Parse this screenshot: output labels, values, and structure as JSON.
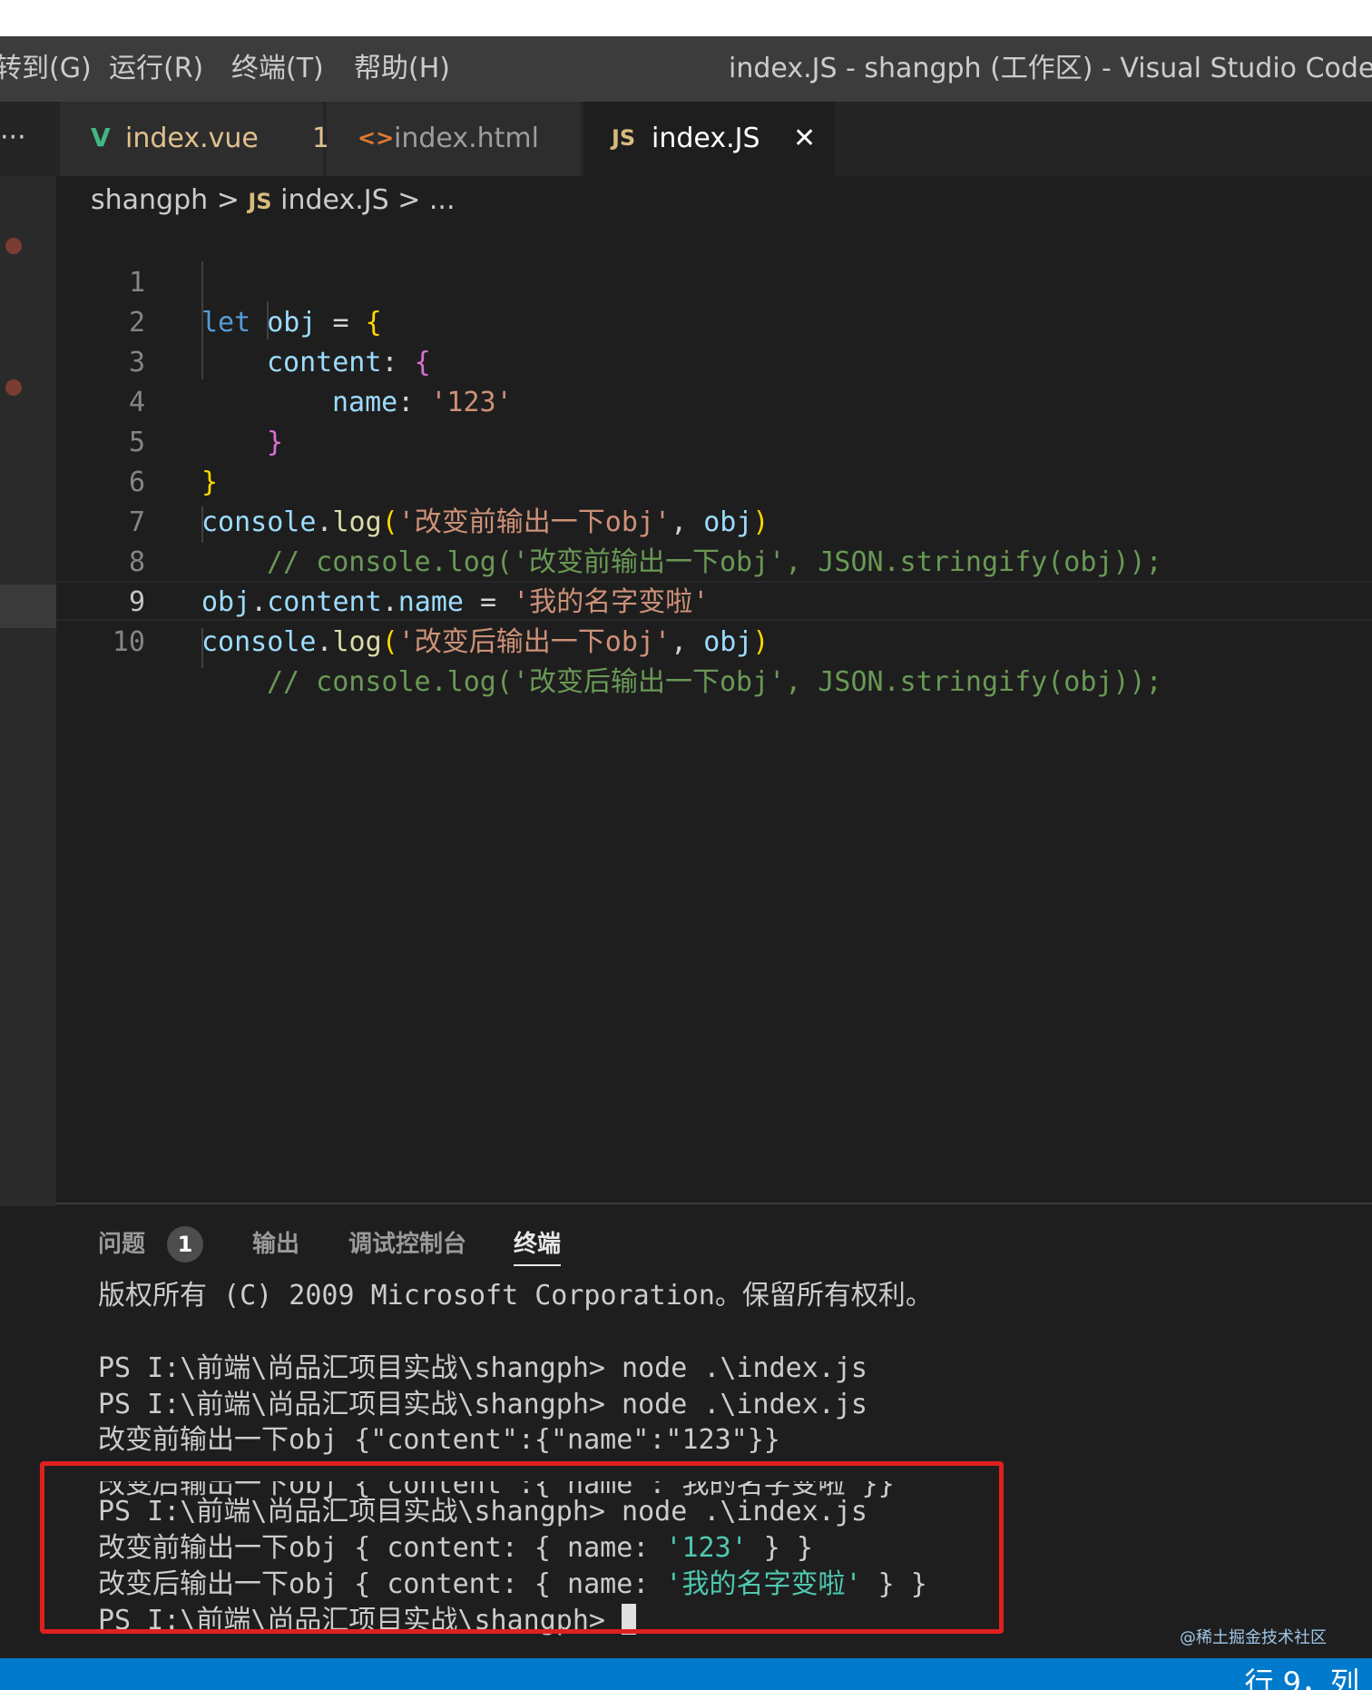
{
  "menu": {
    "items": [
      "转到(G)",
      "运行(R)",
      "终端(T)",
      "帮助(H)"
    ],
    "window_title": "index.JS - shangph (工作区) - Visual Studio Code [管理员]"
  },
  "tabs": {
    "more": "···",
    "items": [
      {
        "icon": "V",
        "label": "index.vue",
        "badge": "1"
      },
      {
        "icon": "<>",
        "label": "index.html"
      },
      {
        "icon": "JS",
        "label": "index.JS",
        "close": "✕"
      }
    ]
  },
  "breadcrumb": {
    "folder": "shangph",
    "sep": ">",
    "icon": "JS",
    "file": "index.JS",
    "tail": "> ..."
  },
  "code": {
    "line_numbers": [
      "1",
      "2",
      "3",
      "4",
      "5",
      "6",
      "7",
      "8",
      "9",
      "10"
    ],
    "current_line": "9",
    "l1": {
      "kw": "let",
      "name": " obj",
      "eq": " = ",
      "brace": "{"
    },
    "l2": {
      "key": "content",
      "colon": ": ",
      "brace": "{"
    },
    "l3": {
      "key": "name",
      "colon": ": ",
      "val": "'123'"
    },
    "l4": {
      "brace": "}"
    },
    "l5": {
      "brace": "}"
    },
    "l6": {
      "obj": "console",
      "dot": ".",
      "fn": "log",
      "open": "(",
      "str": "'改变前输出一下obj'",
      "comma": ", ",
      "arg": "obj",
      "close": ")"
    },
    "l7": {
      "comment": "// console.log('改变前输出一下obj', JSON.stringify(obj));"
    },
    "l8": {
      "a": "obj",
      "dot1": ".",
      "b": "content",
      "dot2": ".",
      "c": "name",
      "eq": " = ",
      "str": "'我的名字变啦'"
    },
    "l9": {
      "obj": "console",
      "dot": ".",
      "fn": "log",
      "open": "(",
      "str": "'改变后输出一下obj'",
      "comma": ", ",
      "arg": "obj",
      "close": ")"
    },
    "l10": {
      "comment": "// console.log('改变后输出一下obj', JSON.stringify(obj));"
    }
  },
  "panel": {
    "tabs": [
      "问题",
      "输出",
      "调试控制台",
      "终端"
    ],
    "problems_count": "1",
    "active_tab": "终端"
  },
  "terminal": {
    "lines": [
      "版权所有 (C) 2009 Microsoft Corporation。保留所有权利。",
      "",
      "PS I:\\前端\\尚品汇项目实战\\shangph> node .\\index.js",
      "PS I:\\前端\\尚品汇项目实战\\shangph> node .\\index.js",
      "改变前输出一下obj {\"content\":{\"name\":\"123\"}}",
      "改变后输出一下obj {\"content\":{\"name\":\"我的名字变啦\"}}",
      "PS I:\\前端\\尚品汇项目实战\\shangph> node .\\index.js"
    ],
    "out1": {
      "prefix": "改变前输出一下obj { content: { name: ",
      "value": "'123'",
      "suffix": " } }"
    },
    "out2": {
      "prefix": "改变后输出一下obj { content: { name: ",
      "value": "'我的名字变啦'",
      "suffix": " } }"
    },
    "prompt": "PS I:\\前端\\尚品汇项目实战\\shangph> "
  },
  "status": {
    "position": "行 9，列",
    "watermark": "@稀土掘金技术社区"
  },
  "annotation": {
    "highlight_color": "#e02020"
  }
}
